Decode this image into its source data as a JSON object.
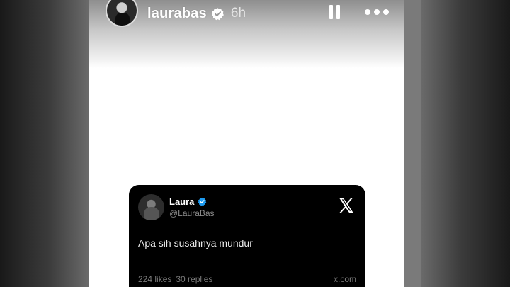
{
  "story": {
    "username": "laurabas",
    "time_ago": "6h",
    "icons": {
      "verified": "verified-badge-icon",
      "pause": "pause-icon",
      "more": "more-options-icon"
    }
  },
  "tweet": {
    "name": "Laura",
    "handle": "@LauraBas",
    "text": "Apa sih susahnya mundur",
    "likes": "224 likes",
    "replies": "30 replies",
    "source": "x.com",
    "icons": {
      "verified": "verified-badge-icon",
      "brand": "x-logo-icon"
    }
  },
  "colors": {
    "verified_blue": "#1d9bf0",
    "card_background": "#000000",
    "story_background": "#ffffff"
  }
}
